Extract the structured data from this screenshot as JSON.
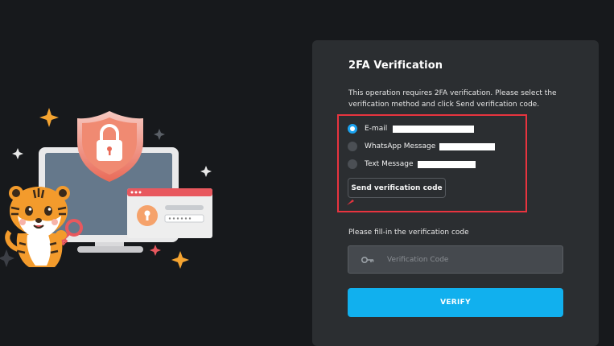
{
  "panel": {
    "title": "2FA Verification",
    "description": "This operation requires 2FA verification. Please select the verification method and click Send verification code."
  },
  "methods": [
    {
      "label": "E-mail",
      "selected": true
    },
    {
      "label": "WhatsApp Message",
      "selected": false
    },
    {
      "label": "Text Message",
      "selected": false
    }
  ],
  "send_button": {
    "label": "Send verification code"
  },
  "code": {
    "label": "Please fill-in the verification code",
    "placeholder": "Verification Code"
  },
  "verify_button": {
    "label": "VERIFY"
  },
  "colors": {
    "background": "#17191c",
    "panel": "#2b2e31",
    "accent": "#11b0ee",
    "highlight": "#e8343f"
  },
  "icons": [
    "shield-lock-icon",
    "monitor-icon",
    "tiger-mascot",
    "key-icon",
    "sparkle-icon",
    "lock-badge-icon"
  ]
}
